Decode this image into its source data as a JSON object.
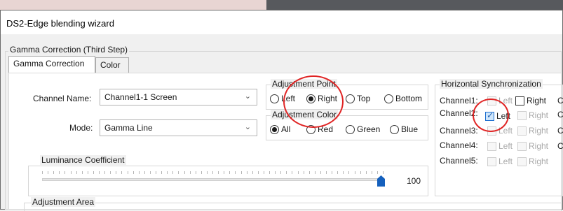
{
  "window": {
    "title": "DS2-Edge blending wizard"
  },
  "gamma_group_title": "Gamma Correction (Third Step)",
  "tabs": [
    {
      "label": "Gamma Correction",
      "active": true
    },
    {
      "label": "Color",
      "active": false
    }
  ],
  "channel_name": {
    "label": "Channel Name:",
    "value": "Channel1-1 Screen"
  },
  "mode": {
    "label": "Mode:",
    "value": "Gamma Line"
  },
  "adjustment_point": {
    "title": "Adjustment Point",
    "options": [
      {
        "label": "Left",
        "selected": false
      },
      {
        "label": "Right",
        "selected": true
      },
      {
        "label": "Top",
        "selected": false
      },
      {
        "label": "Bottom",
        "selected": false
      }
    ]
  },
  "adjustment_color": {
    "title": "Adjustment Color",
    "options": [
      {
        "label": "All",
        "selected": true
      },
      {
        "label": "Red",
        "selected": false
      },
      {
        "label": "Green",
        "selected": false
      },
      {
        "label": "Blue",
        "selected": false
      }
    ]
  },
  "horizontal_sync": {
    "title": "Horizontal Synchronization",
    "rows": [
      {
        "label": "Channel1:",
        "left": "Left",
        "right": "Right",
        "extra": "C"
      },
      {
        "label": "Channel2:",
        "left": "Left",
        "right": "Right",
        "extra": "C"
      },
      {
        "label": "Channel3:",
        "left": "Left",
        "right": "Right",
        "extra": "C"
      },
      {
        "label": "Channel4:",
        "left": "Left",
        "right": "Right",
        "extra": "C"
      },
      {
        "label": "Channel5:",
        "left": "Left",
        "right": "Right",
        "extra": ""
      }
    ]
  },
  "luminance": {
    "title": "Luminance Coefficient",
    "value": "100",
    "fraction": 1.0
  },
  "adjustment_area": {
    "title": "Adjustment Area"
  },
  "colors": {
    "highlight": "#e02424",
    "slider_thumb": "#1560bd"
  }
}
